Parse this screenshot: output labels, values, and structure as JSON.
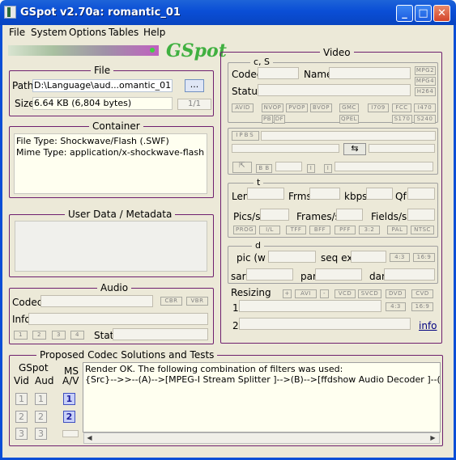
{
  "window": {
    "title": "GSpot v2.70a: romantic_01",
    "min": "_",
    "max": "□",
    "close": "✕"
  },
  "menu": [
    "File",
    "System",
    "Options",
    "Tables",
    "Help"
  ],
  "logo": "GSpot",
  "file": {
    "title": "File",
    "path_label": "Path",
    "path_value": "D:\\Language\\aud...omantic_01.swf",
    "browse": "...",
    "size_label": "Size",
    "size_value": "6.64 KB (6,804 bytes)",
    "page": "1/1"
  },
  "container": {
    "title": "Container",
    "lines": [
      "File Type: Shockwave/Flash (.SWF)",
      "Mime Type: application/x-shockwave-flash"
    ]
  },
  "userdata": {
    "title": "User Data / Metadata"
  },
  "audio": {
    "title": "Audio",
    "codec_label": "Codec",
    "cbr": "CBR",
    "vbr": "VBR",
    "info_label": "Info",
    "n1": "1",
    "n2": "2",
    "n3": "3",
    "n4": "4",
    "stat_label": "Stat"
  },
  "video": {
    "title": "Video",
    "cs": "c, S",
    "codec_label": "Codec",
    "name_label": "Name",
    "status_label": "Status",
    "mpg2": "MPG2",
    "mpg4": "MPG4",
    "h264": "H264",
    "avid": "AVID",
    "nvop": "NVOP",
    "pvop": "PVOP",
    "bvop": "BVOP",
    "gmc": "GMC",
    "i709": "I709",
    "fcc": "FCC",
    "i470": "I470",
    "pb": "PB",
    "df": "DF",
    "qpel": "QPEL",
    "s170": "S170",
    "s240": "S240",
    "ipbs": "IPBS",
    "t": "t",
    "len": "Len",
    "frms": "Frms",
    "kbps": "kbps",
    "qf": "Qf",
    "pics": "Pics/s",
    "frames": "Frames/s",
    "fields": "Fields/s",
    "prog": "PROG",
    "il": "I/L",
    "tff": "TFF",
    "bff": "BFF",
    "pff": "PFF",
    "r32": "3:2",
    "pal": "PAL",
    "ntsc": "NTSC",
    "d": "d",
    "pic": "pic (w x",
    "seqext": "seq ext",
    "r43": "4:3",
    "r169": "16:9",
    "sar": "sar",
    "par": "par",
    "dar": "dar",
    "resizing": "Resizing",
    "plus": "+",
    "avi": "AVI",
    "minus": "-",
    "vcd": "VCD",
    "svcd": "SVCD",
    "dvd": "DVD",
    "cvd": "CVD",
    "one": "1",
    "two": "2",
    "info": "info"
  },
  "codecs": {
    "title": "Proposed Codec Solutions and Tests",
    "gspot": "GSpot",
    "vid": "Vid",
    "aud": "Aud",
    "ms": "MS",
    "av": "A/V",
    "n1": "1",
    "n2": "2",
    "n3": "3",
    "render_lines": [
      "Render OK. The following combination of filters was used:",
      "{Src}-->>--(A)-->[MPEG-I Stream Splitter ]-->(B)-->[ffdshow Audio Decoder ]--(C)-->[Default Dire"
    ]
  },
  "colors": {
    "titlebar": "#0a4ed6",
    "group_border": "#6e1f6e",
    "logo": "#40b040"
  }
}
